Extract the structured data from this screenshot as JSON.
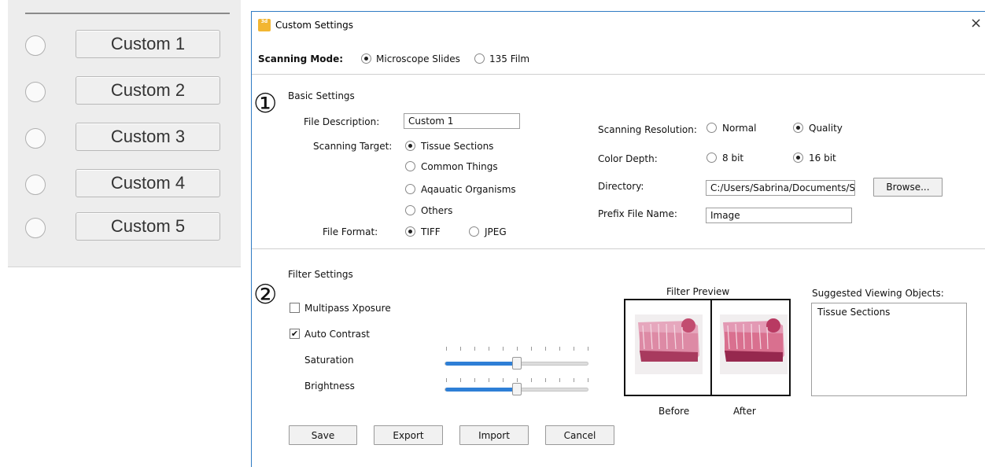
{
  "left_panel": {
    "items": [
      {
        "label": "Custom 1"
      },
      {
        "label": "Custom 2"
      },
      {
        "label": "Custom 3"
      },
      {
        "label": "Custom 4"
      },
      {
        "label": "Custom 5"
      }
    ]
  },
  "dialog": {
    "title": "Custom Settings",
    "icon_text": "3d",
    "close_glyph": "×",
    "scanning_mode": {
      "label": "Scanning Mode:",
      "options": [
        "Microscope Slides",
        "135 Film"
      ],
      "selected": "Microscope Slides"
    },
    "basic": {
      "number": "①",
      "heading": "Basic Settings",
      "file_description_label": "File Description:",
      "file_description_value": "Custom 1",
      "scanning_target_label": "Scanning Target:",
      "targets": [
        "Tissue Sections",
        "Common Things",
        "Aqauatic Organisms",
        "Others"
      ],
      "target_selected": "Tissue Sections",
      "file_format_label": "File Format:",
      "formats": [
        "TIFF",
        "JPEG"
      ],
      "format_selected": "TIFF",
      "resolution_label": "Scanning Resolution:",
      "resolutions": [
        "Normal",
        "Quality"
      ],
      "resolution_selected": "Quality",
      "color_depth_label": "Color Depth:",
      "depths": [
        "8 bit",
        "16 bit"
      ],
      "depth_selected": "16 bit",
      "directory_label": "Directory:",
      "directory_value": "C:/Users/Sabrina/Documents/S",
      "browse_label": "Browse...",
      "prefix_label": "Prefix File Name:",
      "prefix_value": "Image"
    },
    "filter": {
      "number": "②",
      "heading": "Filter Settings",
      "multipass_label": "Multipass Xposure",
      "multipass_checked": false,
      "auto_contrast_label": "Auto Contrast",
      "auto_contrast_checked": true,
      "check_glyph": "✔",
      "saturation_label": "Saturation",
      "saturation_level": 0.5,
      "brightness_label": "Brightness",
      "brightness_level": 0.5,
      "preview_title": "Filter Preview",
      "before_label": "Before",
      "after_label": "After",
      "suggested_title": "Suggested Viewing Objects:",
      "suggested_items": [
        "Tissue Sections"
      ]
    },
    "buttons": {
      "save": "Save",
      "export": "Export",
      "import": "Import",
      "cancel": "Cancel"
    }
  },
  "colors": {
    "window_border": "#2f7bc4",
    "slider_fill": "#2e7fd6",
    "tissue_pink": "#d9708f",
    "tissue_dark": "#a83a5e"
  }
}
